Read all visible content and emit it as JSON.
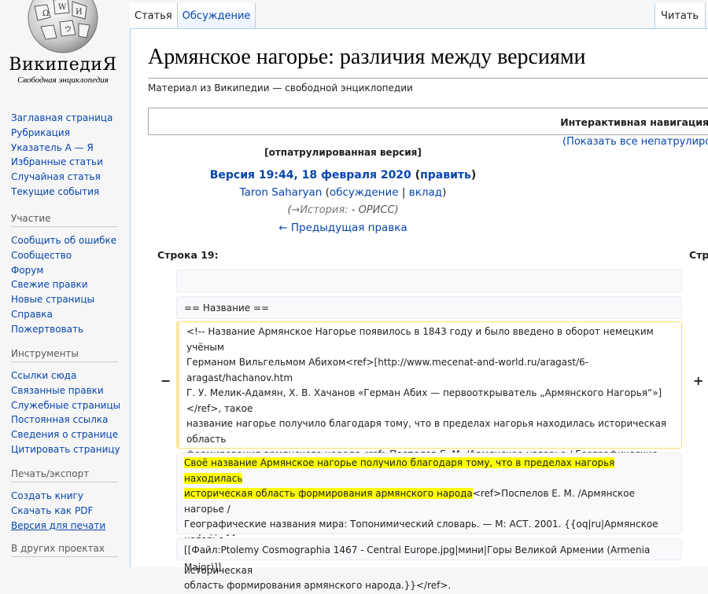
{
  "logo": {
    "wordmark": "ВикипедиЯ",
    "tagline": "Свободная энциклопедия"
  },
  "sidebar": {
    "navigation": [
      "Заглавная страница",
      "Рубрикация",
      "Указатель А — Я",
      "Избранные статьи",
      "Случайная статья",
      "Текущие события"
    ],
    "participation": {
      "heading": "Участие",
      "items": [
        "Сообщить об ошибке",
        "Сообщество",
        "Форум",
        "Свежие правки",
        "Новые страницы",
        "Справка",
        "Пожертвовать"
      ]
    },
    "tools": {
      "heading": "Инструменты",
      "items": [
        "Ссылки сюда",
        "Связанные правки",
        "Служебные страницы",
        "Постоянная ссылка",
        "Сведения о странице",
        "Цитировать страницу"
      ]
    },
    "print": {
      "heading": "Печать/экспорт",
      "items": [
        "Создать книгу",
        "Скачать как PDF",
        "Версия для печати"
      ]
    },
    "other_projects": {
      "heading": "В других проектах"
    }
  },
  "tabs": {
    "article": "Статья",
    "talk": "Обсуждение",
    "read": "Читать",
    "edit_stub": "Т"
  },
  "page": {
    "title": "Армянское нагорье: различия между версиями",
    "tagline": "Материал из Википедии — свободной энциклопедии",
    "nav_title": "Интерактивная навигация",
    "show_unpatrolled": "(Показать все непатрулиров",
    "patrolled": "[отпатрулированная версия]",
    "version_label": "Версия 19:44, 18 февраля 2020",
    "version_open": " (",
    "version_edit": "правка",
    "version_edit_text": "править",
    "version_close": ")",
    "author": "Taron Saharyan",
    "author_open": " (",
    "author_talk": "обсуждение",
    "author_sep": " | ",
    "author_contrib": "вклад",
    "author_close": ")",
    "summary_open": "(",
    "summary_link": "→История:",
    "summary_rest": " - ОРИСС)",
    "prev_edit": "← Предыдущая правка"
  },
  "diff": {
    "line_left": "Строка 19:",
    "line_right": "Стр",
    "minus": "−",
    "plus": "+",
    "context_heading": "== Название ==",
    "deleted": "<!-- Название Армянское Нагорье появилось в 1843 году и было введено в оборот немецким учёным\nГерманом Вильгельмом Абихом<ref>[http://www.mecenat-and-world.ru/aragast/6-aragast/hachanov.htm\nГ. У. Мелик-Адамян, Х. В. Хачанов «Герман Абих — первооткрыватель „Армянского Нагорья“»]</ref>, такое\nназвание нагорье получило благодаря тому, что в пределах нагорья находилась историческая область\nформирования армянского народа<ref>Поспелов Е. М. /Армянское нагорье / Географические названия\nмира: Топонимический словарь. — М: АСТ. 2001. {{oq|ru|Армянское нагорье. <br>Турция, Армения, Иран.\nНазвание обусловлено тем, что в пределах нагорья находилась истор. обл. формирования арм. народа.}}\n</ref> и армянских государств.-->",
    "para_highlight_1": "Своё название Армянское нагорье получило благодаря тому, что в пределах нагорья находилась",
    "para_highlight_2": "историческая область формирования армянского народа",
    "para_rest_1": "<ref>Поспелов Е. М. /Армянское нагорье /",
    "para_rest_2": "Географические названия мира: Топонимический словарь. — М: АСТ. 2001. {{oq|ru|Армянское нагорье.",
    "para_rest_3": "Турция, Армения, Иран. Название обусловлено тем, что в пределах нагорья находилась историческая",
    "para_rest_4": "область формирования армянского народа.}}</ref>.",
    "context_file": "[[Файл:Ptolemy Cosmographia 1467 - Central Europe.jpg|мини|Горы Великой Армении (Armenia Major)]]"
  }
}
